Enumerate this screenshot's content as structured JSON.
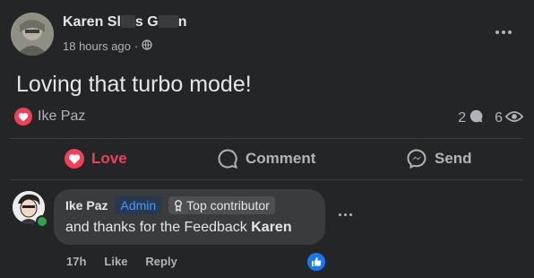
{
  "post": {
    "author": {
      "name_start": "Karen Sl",
      "name_mid1": "s G",
      "name_end": "n"
    },
    "timestamp": "18 hours ago",
    "privacy_icon": "globe-icon",
    "text": "Loving that turbo mode!",
    "reactions": {
      "icon": "love-reaction-icon",
      "reactor": "Ike Paz"
    },
    "comment_count": "2",
    "view_count": "6"
  },
  "actions": {
    "love_label": "Love",
    "comment_label": "Comment",
    "send_label": "Send"
  },
  "comment": {
    "author": "Ike Paz",
    "admin_badge": "Admin",
    "top_badge": "Top contributor",
    "text_prefix": "and thanks for the Feedback",
    "text_name": "Karen",
    "time": "17h",
    "like_label": "Like",
    "reply_label": "Reply"
  },
  "colors": {
    "background": "#242526",
    "love": "#f33e58",
    "like": "#1877f2",
    "admin": "#4599ff"
  }
}
